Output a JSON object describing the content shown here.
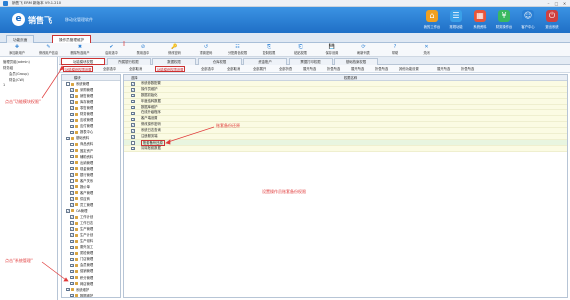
{
  "window": {
    "title": "销售飞 ERM 新版本 V9.1.210",
    "min": "–",
    "max": "□",
    "close": "✕"
  },
  "banner": {
    "logo_glyph": "e",
    "brand": "销售飞",
    "slogan": "移动化管理软件",
    "accent": "#1f6fc6"
  },
  "top_buttons": [
    {
      "label": "我的工作台",
      "glyph": "⌂",
      "color": "#f0a020"
    },
    {
      "label": "常规功能",
      "glyph": "☰",
      "color": "#3aa0e8"
    },
    {
      "label": "系统资料",
      "glyph": "▦",
      "color": "#e8553a"
    },
    {
      "label": "财务操作台",
      "glyph": "¥",
      "color": "#3ab860"
    },
    {
      "label": "客户中心",
      "glyph": "☺",
      "color": "#2a7fd4"
    },
    {
      "label": "退出系统",
      "glyph": "⏻",
      "color": "#d04040"
    }
  ],
  "tabs": [
    {
      "label": "功能页面"
    },
    {
      "label": "操作员管理维护"
    }
  ],
  "toolbar": [
    {
      "label": "添加新用户",
      "glyph": "✚"
    },
    {
      "label": "修改用户信息",
      "glyph": "✎"
    },
    {
      "label": "删除所选用户",
      "glyph": "✖"
    },
    {
      "label": "启用选中",
      "glyph": "✔"
    },
    {
      "label": "禁用选中",
      "glyph": "⊘"
    },
    {
      "label": "修改密码",
      "glyph": "🔑"
    },
    {
      "label": "重置密码",
      "glyph": "↺"
    },
    {
      "label": "分配角色权限",
      "glyph": "☷"
    },
    {
      "label": "复制权限",
      "glyph": "⎘"
    },
    {
      "label": "粘贴权限",
      "glyph": "⎗"
    },
    {
      "label": "保存设置",
      "glyph": "💾"
    },
    {
      "label": "刷新列表",
      "glyph": "⟳"
    },
    {
      "label": "帮助",
      "glyph": "?"
    },
    {
      "label": "关闭",
      "glyph": "✕"
    }
  ],
  "left_tree": [
    {
      "label": "管理员组(admin)",
      "indent": 0
    },
    {
      "label": "财务组",
      "indent": 0
    },
    {
      "label": "会员(Group)",
      "indent": 1
    },
    {
      "label": "财会(CW)",
      "indent": 1
    },
    {
      "label": "1",
      "indent": 0
    }
  ],
  "subtabs": [
    {
      "label": "功能模块权限"
    },
    {
      "label": "所属银行权限"
    },
    {
      "label": "数据权限"
    },
    {
      "label": "仓库权限"
    },
    {
      "label": "资金账户"
    },
    {
      "label": "票据打印权限"
    },
    {
      "label": "基础档案权限"
    }
  ],
  "filterbar": [
    {
      "label": "功能模块权限设置"
    },
    {
      "label": "全部选中"
    },
    {
      "label": "全部取消"
    },
    {
      "label": "功能模块权限设置"
    },
    {
      "label": "全部选中"
    },
    {
      "label": "全部取消"
    },
    {
      "label": "全部展开"
    },
    {
      "label": "全部折叠"
    },
    {
      "label": "展开所选"
    },
    {
      "label": "折叠所选"
    },
    {
      "label": "展开所选"
    },
    {
      "label": "折叠所选"
    },
    {
      "label": "其他功能设置"
    },
    {
      "label": "展开所选"
    },
    {
      "label": "折叠所选"
    }
  ],
  "modules": {
    "header": "模块",
    "rows": [
      {
        "label": "系统管理",
        "checked": false,
        "indent": 0
      },
      {
        "label": "采购管理",
        "checked": true,
        "indent": 1
      },
      {
        "label": "销售管理",
        "checked": true,
        "indent": 1
      },
      {
        "label": "库存管理",
        "checked": true,
        "indent": 1
      },
      {
        "label": "零售管理",
        "checked": true,
        "indent": 1
      },
      {
        "label": "财务管理",
        "checked": true,
        "indent": 1
      },
      {
        "label": "应收管理",
        "checked": true,
        "indent": 1
      },
      {
        "label": "应付管理",
        "checked": true,
        "indent": 1
      },
      {
        "label": "报表中心",
        "checked": true,
        "indent": 1
      },
      {
        "label": "基础资料",
        "checked": true,
        "indent": 0
      },
      {
        "label": "商品资料",
        "checked": false,
        "indent": 1
      },
      {
        "label": "固定资产",
        "checked": false,
        "indent": 1
      },
      {
        "label": "辅助资料",
        "checked": false,
        "indent": 1
      },
      {
        "label": "出纳管理",
        "checked": true,
        "indent": 1
      },
      {
        "label": "现金管理",
        "checked": true,
        "indent": 1
      },
      {
        "label": "银行管理",
        "checked": true,
        "indent": 1
      },
      {
        "label": "客户关系",
        "checked": false,
        "indent": 1
      },
      {
        "label": "报价单",
        "checked": true,
        "indent": 1
      },
      {
        "label": "客户管理",
        "checked": true,
        "indent": 1
      },
      {
        "label": "供应商",
        "checked": true,
        "indent": 1
      },
      {
        "label": "员工管理",
        "checked": true,
        "indent": 1
      },
      {
        "label": "OA管理",
        "checked": true,
        "indent": 0
      },
      {
        "label": "工作计划",
        "checked": true,
        "indent": 1
      },
      {
        "label": "工作日志",
        "checked": true,
        "indent": 1
      },
      {
        "label": "生产管理",
        "checked": true,
        "indent": 1
      },
      {
        "label": "生产计划",
        "checked": true,
        "indent": 1
      },
      {
        "label": "生产领料",
        "checked": true,
        "indent": 1
      },
      {
        "label": "委外加工",
        "checked": true,
        "indent": 1
      },
      {
        "label": "质检管理",
        "checked": true,
        "indent": 1
      },
      {
        "label": "门店管理",
        "checked": true,
        "indent": 1
      },
      {
        "label": "会员管理",
        "checked": true,
        "indent": 1
      },
      {
        "label": "促销管理",
        "checked": true,
        "indent": 1
      },
      {
        "label": "积分管理",
        "checked": true,
        "indent": 1
      },
      {
        "label": "网店管理",
        "checked": true,
        "indent": 1
      },
      {
        "label": "系统维护",
        "checked": true,
        "indent": 0
      },
      {
        "label": "数据维护",
        "checked": true,
        "indent": 1
      },
      {
        "label": "系统管理",
        "checked": true,
        "indent": 1,
        "highlight": true
      }
    ]
  },
  "permissions": {
    "header_check": "选择",
    "header_label": "权限名称",
    "rows": [
      {
        "label": "系统参数配置",
        "checked": true
      },
      {
        "label": "操作员维护",
        "checked": true
      },
      {
        "label": "数据初始化",
        "checked": true
      },
      {
        "label": "年度结转数据",
        "checked": true
      },
      {
        "label": "数据库维护",
        "checked": true
      },
      {
        "label": "在线升级程序",
        "checked": true
      },
      {
        "label": "客户端设置",
        "checked": true
      },
      {
        "label": "修改操作密码",
        "checked": true
      },
      {
        "label": "系统日志查询",
        "checked": true
      },
      {
        "label": "注册服务端",
        "checked": true
      },
      {
        "label": "账套备份还原",
        "checked": false,
        "highlight": true,
        "selected": true
      },
      {
        "label": "清除账套数据",
        "checked": true
      }
    ]
  },
  "annotations": {
    "a1": "点击\"功能模块权限\"",
    "a2": "点击\"系统管理\"",
    "a3": "账套备份还原",
    "a4": "设置操作员账套备份权限"
  }
}
